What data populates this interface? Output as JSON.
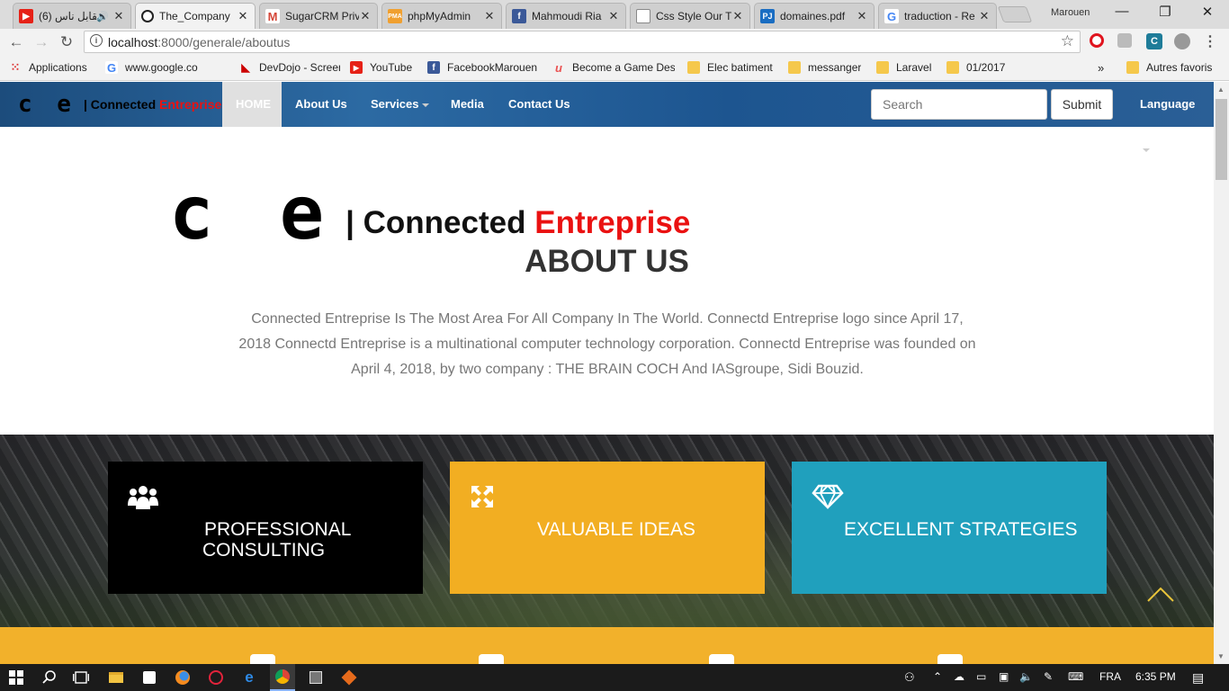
{
  "browser": {
    "tabs": [
      {
        "title": "(6) نقابل ناس",
        "icon": "youtube-icon",
        "color": "#e62117"
      },
      {
        "title": "The_Company",
        "icon": "github-icon",
        "color": "#222222"
      },
      {
        "title": "SugarCRM Priv",
        "icon": "gmail-icon",
        "color": "#d44638"
      },
      {
        "title": "phpMyAdmin",
        "icon": "phpmyadmin-icon",
        "color": "#f0a030"
      },
      {
        "title": "Mahmoudi Ria",
        "icon": "facebook-icon",
        "color": "#3b5998"
      },
      {
        "title": "Css Style Our T",
        "icon": "document-icon",
        "color": "#888888"
      },
      {
        "title": "domaines.pdf",
        "icon": "pj-icon",
        "color": "#1a6dc2"
      },
      {
        "title": "traduction - Re",
        "icon": "google-icon",
        "color": "#4285f4"
      }
    ],
    "profile_name": "Marouen",
    "url_host": "localhost",
    "url_path": ":8000/generale/aboutus",
    "bookmarks": [
      {
        "label": "Applications",
        "icon": "apps-grid-icon"
      },
      {
        "label": "www.google.co",
        "icon": "google-icon"
      },
      {
        "label": "DevDojo - Screencas",
        "icon": "devdojo-icon"
      },
      {
        "label": "YouTube",
        "icon": "youtube-icon"
      },
      {
        "label": "FacebookMarouen",
        "icon": "facebook-icon"
      },
      {
        "label": "Become a Game Des",
        "icon": "udemy-icon"
      },
      {
        "label": "Elec batiment",
        "icon": "folder-icon"
      },
      {
        "label": "messanger",
        "icon": "folder-icon"
      },
      {
        "label": "Laravel",
        "icon": "folder-icon"
      },
      {
        "label": "01/2017",
        "icon": "folder-icon"
      }
    ],
    "bookmarks_more": "»",
    "other_bookmarks": "Autres favoris"
  },
  "navbar": {
    "brand_logo": "c e",
    "brand_sep": "| ",
    "brand_connected": "Connected ",
    "brand_entreprise": "Entreprise",
    "links": [
      {
        "label": "HOME",
        "active": true
      },
      {
        "label": "About Us"
      },
      {
        "label": "Services",
        "dropdown": true
      },
      {
        "label": "Media"
      },
      {
        "label": "Contact Us"
      }
    ],
    "search_placeholder": "Search",
    "submit_label": "Submit",
    "language_label": "Language"
  },
  "about": {
    "logo_letters": "c e",
    "logo_sep": "| ",
    "logo_connected": "Connected ",
    "logo_entreprise": "Entreprise",
    "title": "ABOUT US",
    "text": "Connected Entreprise Is The Most Area For All Company In The World. Connectd Entreprise logo since April 17, 2018 Connectd Entreprise is a multinational computer technology corporation. Connectd Entreprise was founded on April 4, 2018, by two company : THE BRAIN COCH And IASgroupe, Sidi Bouzid."
  },
  "cards": [
    {
      "label_line1": "PROFESSIONAL",
      "label_line2": "CONSULTING",
      "icon": "users-icon",
      "color": "#000000"
    },
    {
      "label_line1": "VALUABLE IDEAS",
      "label_line2": "",
      "icon": "expand-arrows-icon",
      "color": "#f2ae22"
    },
    {
      "label_line1": "EXCELLENT STRATEGIES",
      "label_line2": "",
      "icon": "diamond-icon",
      "color": "#20a0bd"
    }
  ],
  "colors": {
    "accent_red": "#ea1111",
    "footer_yellow": "#f2b12b",
    "scroll_top_yellow": "#e8c43a"
  },
  "taskbar": {
    "language": "FRA",
    "time": "6:35 PM"
  }
}
